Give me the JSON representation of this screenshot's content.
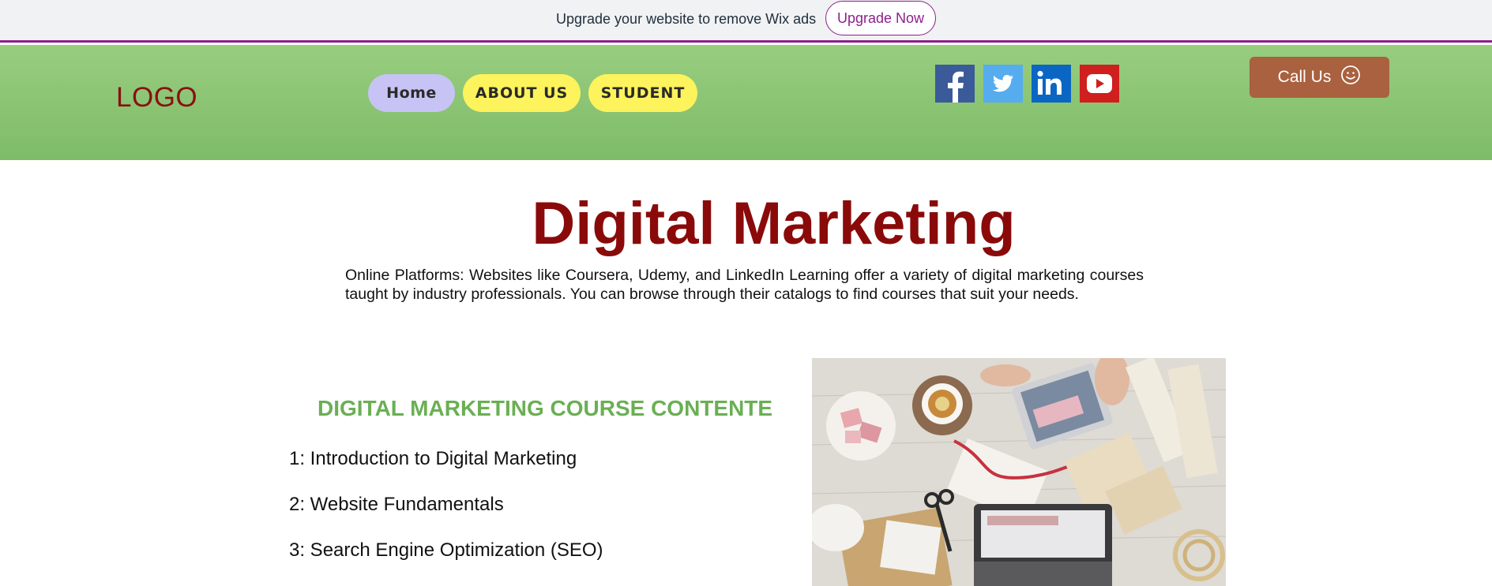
{
  "adbar": {
    "text": "Upgrade your website to remove Wix ads",
    "button_label": "Upgrade Now"
  },
  "header": {
    "logo": "LOGO",
    "nav": [
      {
        "label": "Home"
      },
      {
        "label": "ABOUT US"
      },
      {
        "label": "STUDENT"
      }
    ],
    "social": [
      {
        "icon": "facebook-icon",
        "color": "#3b5a9a"
      },
      {
        "icon": "twitter-icon",
        "color": "#55acee"
      },
      {
        "icon": "linkedin-icon",
        "color": "#0a66c2"
      },
      {
        "icon": "youtube-icon",
        "color": "#cf1f1f"
      }
    ],
    "call_button": {
      "label": "Call Us",
      "icon": "smiley-icon"
    }
  },
  "main": {
    "title": "Digital Marketing",
    "intro": "Online Platforms: Websites like Coursera, Udemy, and LinkedIn Learning offer a variety of digital marketing courses taught by industry professionals. You can browse through their catalogs to find courses that suit your needs.",
    "course_section": {
      "title": "DIGITAL MARKETING COURSE CONTENTE",
      "items": [
        "1: Introduction to Digital Marketing",
        "2: Website Fundamentals",
        "3: Search Engine Optimization (SEO)"
      ]
    }
  },
  "colors": {
    "brand_purple": "#8e1f8a",
    "header_green": "#8cc774",
    "title_red": "#8a0a0a",
    "section_green": "#6aaf54",
    "nav_home": "#c7c3f4",
    "nav_yellow": "#fdf35c",
    "call_button": "#a9613f"
  }
}
